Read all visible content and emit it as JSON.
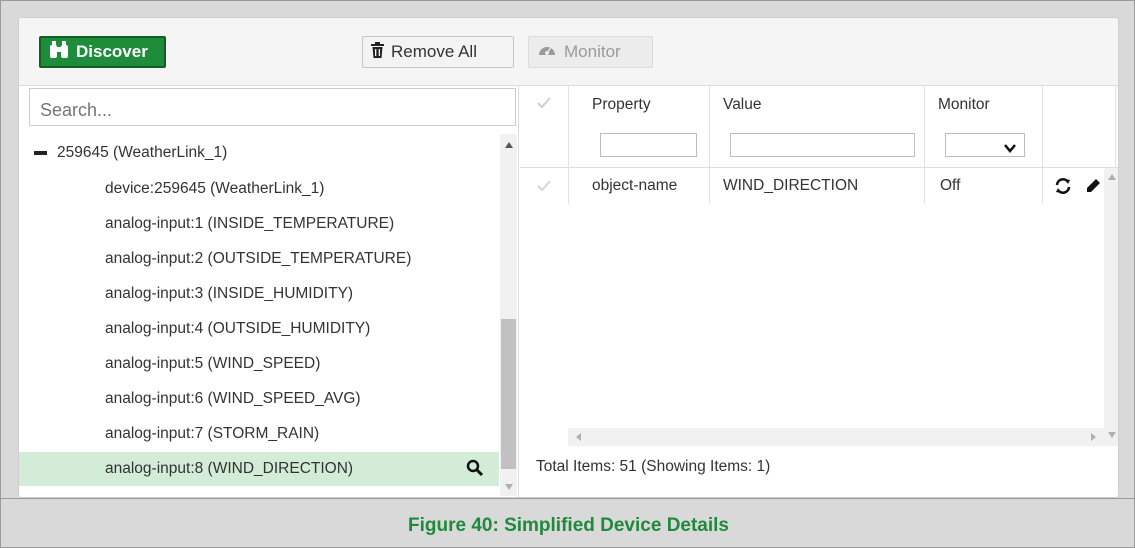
{
  "toolbar": {
    "discover_label": "Discover",
    "remove_all_label": "Remove All",
    "monitor_label": "Monitor"
  },
  "search": {
    "placeholder": "Search..."
  },
  "tree": {
    "parent_label": "259645 (WeatherLink_1)",
    "items": [
      "device:259645 (WeatherLink_1)",
      "analog-input:1 (INSIDE_TEMPERATURE)",
      "analog-input:2 (OUTSIDE_TEMPERATURE)",
      "analog-input:3 (INSIDE_HUMIDITY)",
      "analog-input:4 (OUTSIDE_HUMIDITY)",
      "analog-input:5 (WIND_SPEED)",
      "analog-input:6 (WIND_SPEED_AVG)",
      "analog-input:7 (STORM_RAIN)",
      "analog-input:8 (WIND_DIRECTION)"
    ],
    "selected_index": 8
  },
  "grid": {
    "headers": {
      "property": "Property",
      "value": "Value",
      "monitor": "Monitor"
    },
    "rows": [
      {
        "property": "object-name",
        "value": "WIND_DIRECTION",
        "monitor": "Off"
      }
    ],
    "footer": "Total Items: 51 (Showing Items: 1)"
  },
  "caption": "Figure 40: Simplified Device Details",
  "colors": {
    "accent": "#1e8c3a",
    "selected_row": "#d3ecd7",
    "caption": "#1f8a3c"
  }
}
